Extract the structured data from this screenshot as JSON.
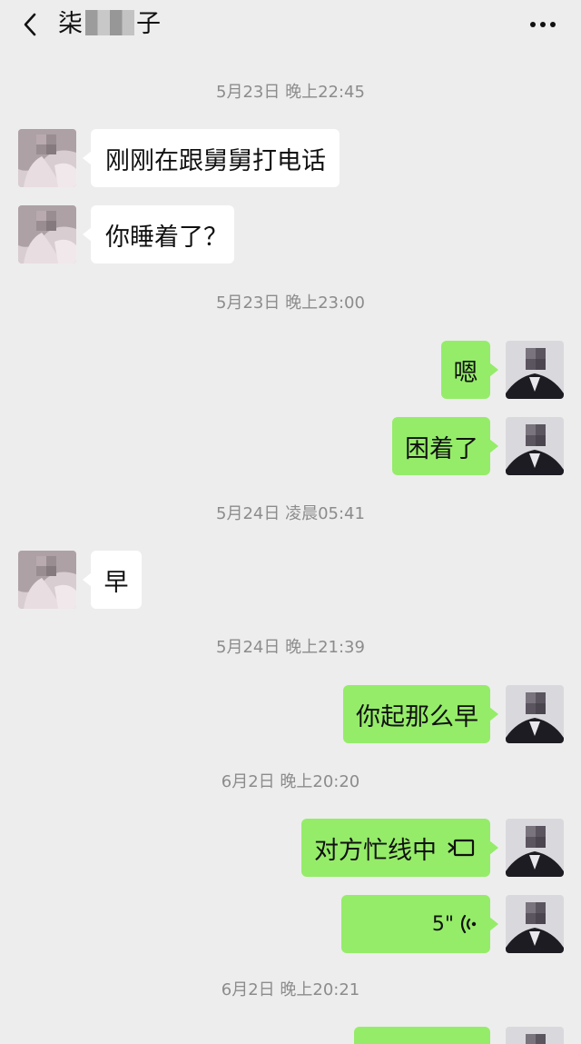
{
  "header": {
    "title_prefix": "柒",
    "title_suffix": "子"
  },
  "colors": {
    "background": "#ededed",
    "outgoing_bubble": "#95ec69",
    "incoming_bubble": "#ffffff",
    "timestamp_text": "#8c8c8c"
  },
  "icons": {
    "back": "chevron-left-icon",
    "more": "more-dots-icon",
    "call": "video-call-icon",
    "voice": "voice-wave-icon"
  },
  "messages": {
    "t1": "5月23日 晚上22:45",
    "m1": "刚刚在跟舅舅打电话",
    "m2": "你睡着了？",
    "t2": "5月23日 晚上23:00",
    "m3": "嗯",
    "m4": "困着了",
    "t3": "5月24日 凌晨05:41",
    "m5": "早",
    "t4": "5月24日 晚上21:39",
    "m6": "你起那么早",
    "t5": "6月2日 晚上20:20",
    "m7": "对方忙线中",
    "m8_duration": "5\"",
    "t6": "6月2日 晚上20:21"
  }
}
